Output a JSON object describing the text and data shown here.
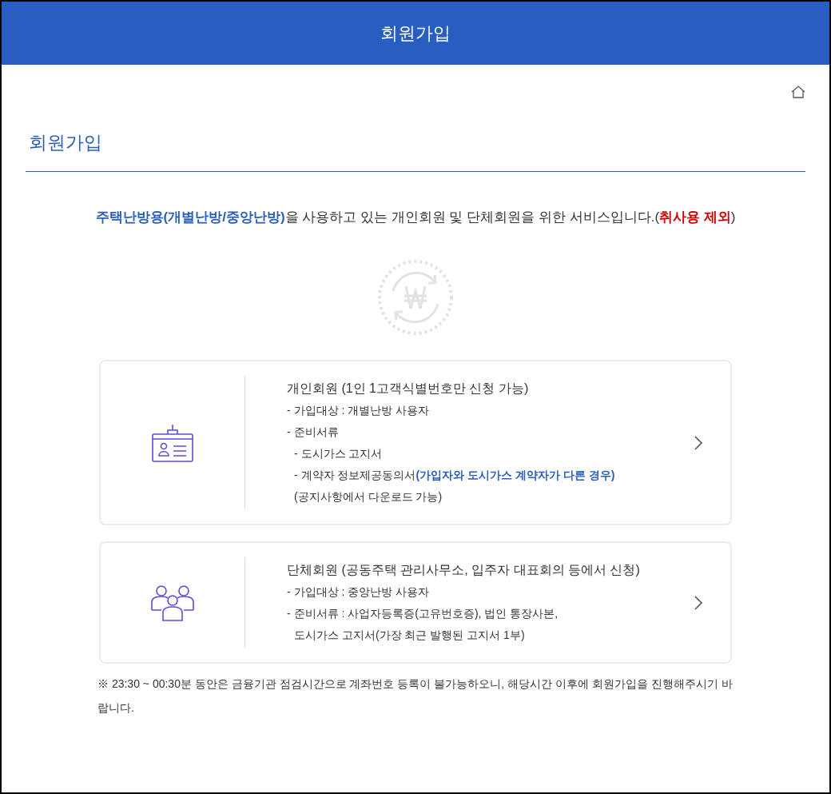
{
  "header": {
    "title": "회원가입"
  },
  "page_title": "회원가입",
  "intro": [
    {
      "kind": "blue",
      "text": "주택난방용(개별난방/중앙난방)"
    },
    {
      "kind": "plain",
      "text": "을 사용하고 있는 개인회원 및 단체회원을 위한 서비스입니다.("
    },
    {
      "kind": "red",
      "text": "취사용 제외"
    },
    {
      "kind": "plain",
      "text": ")"
    }
  ],
  "cards": [
    {
      "kind": "individual",
      "title": "개인회원 (1인 1고객식별번호만 신청 가능)",
      "lines": [
        {
          "indent": false,
          "text": "- 가입대상 : 개별난방 사용자"
        },
        {
          "indent": false,
          "text": "- 준비서류"
        },
        {
          "indent": true,
          "text": "- 도시가스 고지서"
        },
        {
          "indent": true,
          "text": "- 계약자 정보제공동의서",
          "note": "(가입자와 도시가스 계약자가 다른 경우)"
        },
        {
          "indent": true,
          "text": "(공지사항에서 다운로드 가능)"
        }
      ]
    },
    {
      "kind": "group",
      "title": "단체회원 (공동주택 관리사무소, 입주자 대표회의 등에서 신청)",
      "lines": [
        {
          "indent": false,
          "text": "- 가입대상 : 중앙난방 사용자"
        },
        {
          "indent": false,
          "text": "- 준비서류 : 사업자등록증(고유번호증), 법인 통장사본,"
        },
        {
          "indent": true,
          "text": "도시가스 고지서(가장 최근 발행된 고지서 1부)"
        }
      ]
    }
  ],
  "notice": "※ 23:30 ~ 00:30분 동안은 금융기관 점검시간으로 계좌번호 등록이 불가능하오니, 해당시간 이후에 회원가입을 진행해주시기 바랍니다."
}
